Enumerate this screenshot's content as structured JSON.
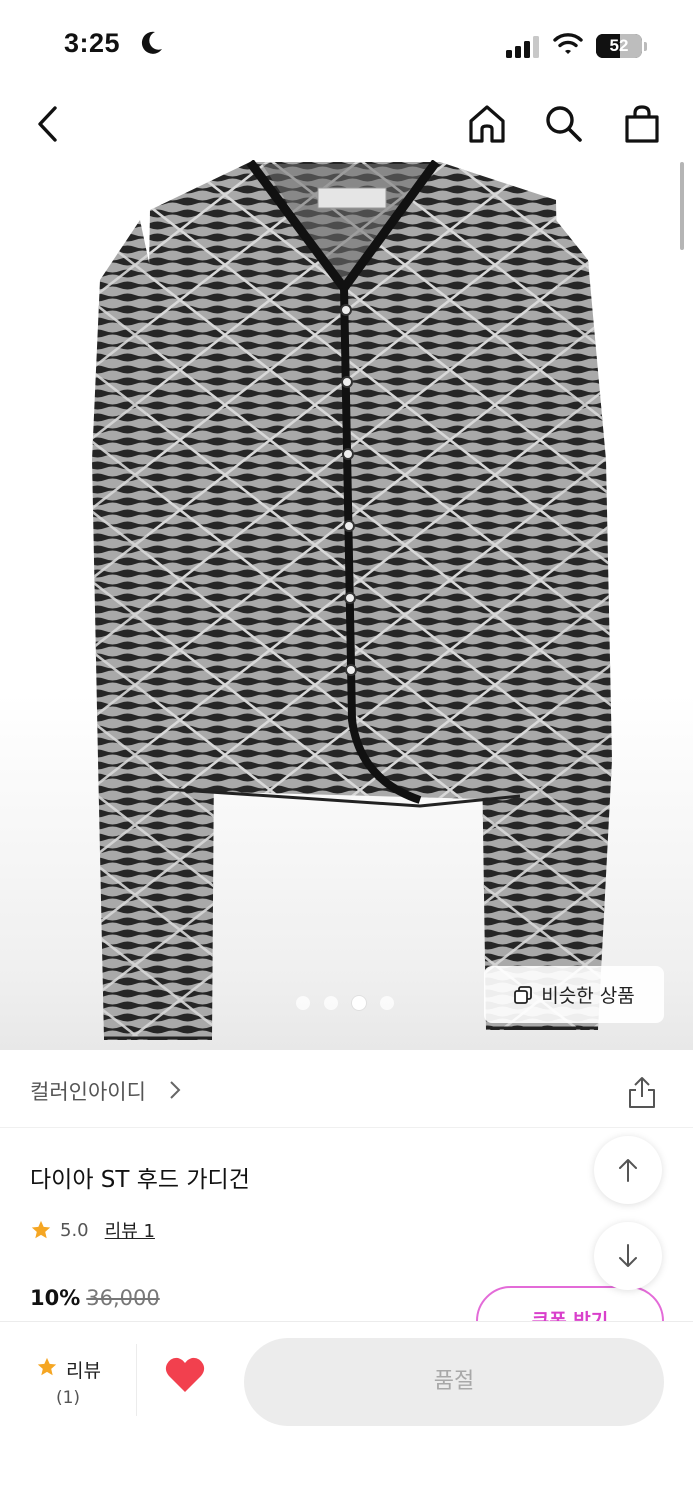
{
  "status_bar": {
    "time": "3:25",
    "battery": "52",
    "battery_level": 0.52
  },
  "nav": {
    "back_icon": "chevron-left-icon",
    "home_icon": "home-icon",
    "search_icon": "search-icon",
    "cart_icon": "shopping-bag-icon"
  },
  "gallery": {
    "page_count": 4,
    "active_index": 2,
    "similar_label": "비슷한 상품"
  },
  "brand": {
    "name": "컬러인아이디"
  },
  "product": {
    "title": "다이아 ST 후드 가디건",
    "rating": "5.0",
    "review_link": "리뷰 1",
    "discount": "10%",
    "original_price": "36,000",
    "coupon_label": "쿠폰 받기"
  },
  "bottom_bar": {
    "review_label": "리뷰",
    "review_count": "(1)",
    "soldout_label": "품절"
  },
  "colors": {
    "accent_pink": "#e36bd8",
    "star": "#f5a623",
    "heart": "#f2404e",
    "soldout_bg": "#ececec"
  }
}
